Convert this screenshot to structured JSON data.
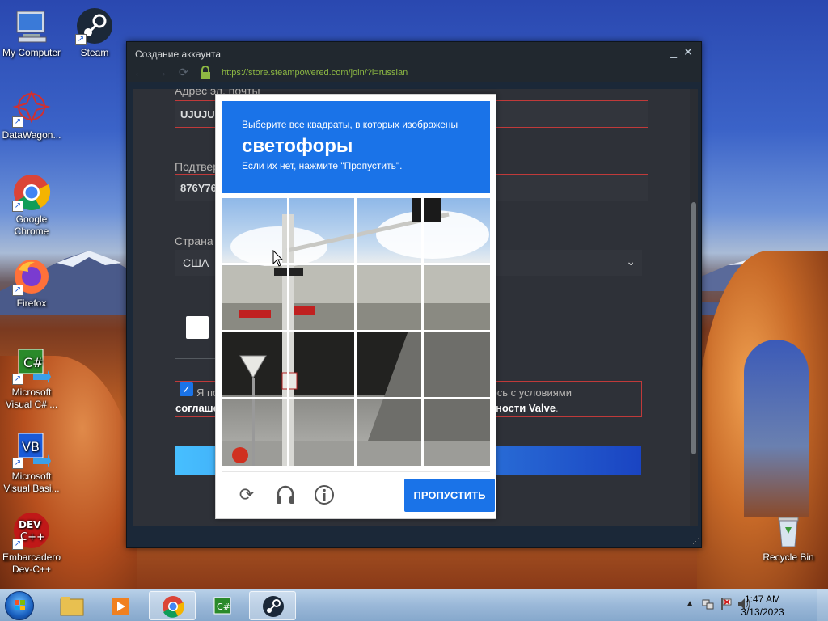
{
  "desktop": {
    "icons": [
      {
        "label": "My Computer"
      },
      {
        "label": "Steam"
      },
      {
        "label": "DataWagon..."
      },
      {
        "label": "Google Chrome"
      },
      {
        "label": "Firefox"
      },
      {
        "label": "Microsoft Visual C# ..."
      },
      {
        "label": "Microsoft Visual Basi..."
      },
      {
        "label": "Embarcadero Dev-C++"
      },
      {
        "label": "Recycle Bin"
      }
    ]
  },
  "window": {
    "title": "Создание аккаунта",
    "url": "https://store.steampowered.com/join/?l=russian",
    "form": {
      "email_label": "Адрес эл. почты",
      "email_value": "UJUJUS",
      "confirm_label": "Подтвер",
      "confirm_value": "876Y76",
      "country_label": "Страна",
      "country_value": "США",
      "agree_text_left": "Я по",
      "agree_text_right": "юсь с условиями",
      "agree_line2_left": "соглаше",
      "agree_line2_right": "ности Valve",
      "agree_line2_suffix": "."
    }
  },
  "captcha": {
    "line1": "Выберите все квадраты, в которых изображены",
    "line2": "светофоры",
    "line3": "Если их нет, нажмите \"Пропустить\".",
    "skip_label": "ПРОПУСТИТЬ",
    "icons": [
      "reload-icon",
      "audio-icon",
      "info-icon"
    ]
  },
  "taskbar": {
    "time": "1:47 AM",
    "date": "3/13/2023"
  },
  "colors": {
    "steam_bg": "#1b2838",
    "captcha_blue": "#1a73e8",
    "error_red": "#c03a3a"
  }
}
